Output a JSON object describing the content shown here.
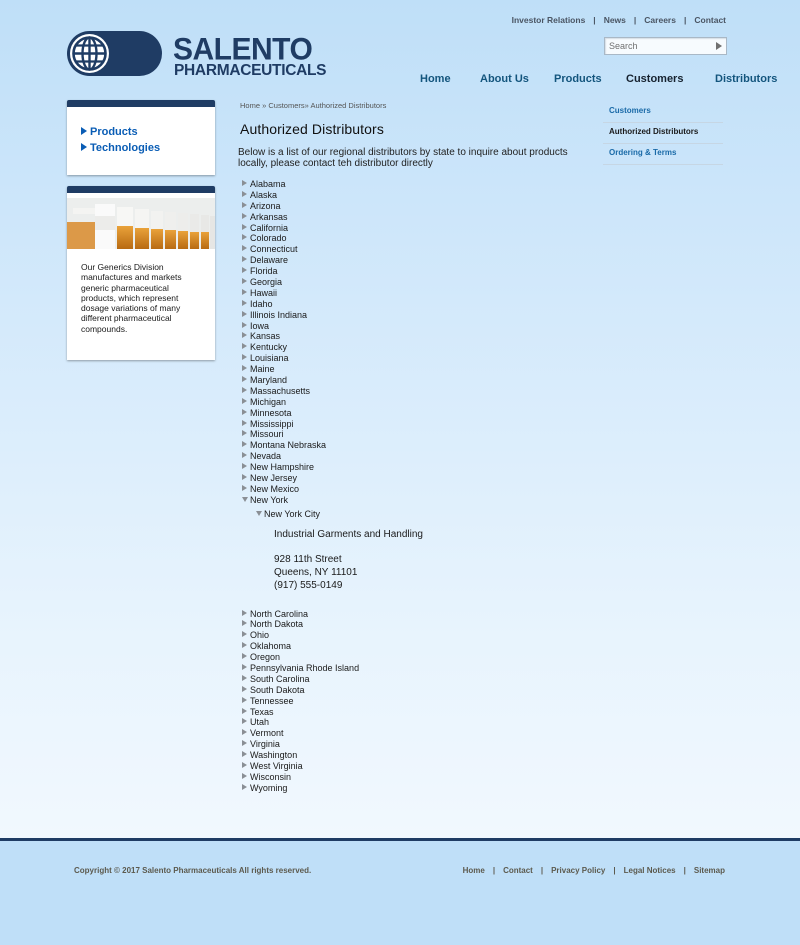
{
  "top_nav": {
    "links": [
      "Investor Relations",
      "News",
      "Careers",
      "Contact"
    ],
    "separator": "|"
  },
  "logo": {
    "line1": "SALENTO",
    "line2": "PHARMACEUTICALS",
    "brand_color": "#1f3c64"
  },
  "search": {
    "placeholder": "Search",
    "button_icon": "arrow-right-icon"
  },
  "main_nav": {
    "items": [
      "Home",
      "About Us",
      "Products",
      "Customers",
      "Distributors"
    ],
    "active": "Customers"
  },
  "sidebar": {
    "links": [
      "Products",
      "Technologies"
    ],
    "generics_text": "Our Generics Division manufactures and markets generic pharmaceutical products, which represent dosage variations of many different pharmaceutical compounds."
  },
  "breadcrumb": {
    "home": "Home",
    "customers": "Customers",
    "current": "Authorized Distributors",
    "sep": "»"
  },
  "page": {
    "title": "Authorized Distributors",
    "intro": "Below is a list of our regional distributors by state to inquire about products locally, please contact teh distributor directly"
  },
  "states_before": [
    "Alabama",
    "Alaska",
    "Arizona",
    "Arkansas",
    "California",
    "Colorado",
    "Connecticut",
    "Delaware",
    "Florida",
    "Georgia",
    "Hawaii",
    "Idaho",
    "Illinois Indiana",
    "Iowa",
    "Kansas",
    "Kentucky",
    "Louisiana",
    "Maine",
    "Maryland",
    "Massachusetts",
    "Michigan",
    "Minnesota",
    "Mississippi",
    "Missouri",
    "Montana Nebraska",
    "Nevada",
    "New Hampshire",
    "New Jersey",
    "New Mexico"
  ],
  "expanded_state": {
    "name": "New York",
    "city": "New York City",
    "distributor": {
      "name": "Industrial Garments and Handling",
      "street": "928 11th Street",
      "city_line": "Queens, NY 11101",
      "phone": "(917) 555-0149"
    }
  },
  "states_after": [
    "North Carolina",
    "North Dakota",
    "Ohio",
    "Oklahoma",
    "Oregon",
    "Pennsylvania Rhode Island",
    "South Carolina",
    "South Dakota",
    "Tennessee",
    "Texas",
    "Utah",
    "Vermont",
    "Virginia",
    "Washington",
    "West Virginia",
    "Wisconsin",
    "Wyoming"
  ],
  "subnav": {
    "items": [
      "Customers",
      "Authorized Distributors",
      "Ordering & Terms"
    ],
    "active": "Authorized Distributors"
  },
  "footer": {
    "copyright": "Copyright © 2017 Salento Pharmaceuticals All rights reserved.",
    "links": [
      "Home",
      "Contact",
      "Privacy Policy",
      "Legal Notices",
      "Sitemap"
    ],
    "separator": "|"
  }
}
